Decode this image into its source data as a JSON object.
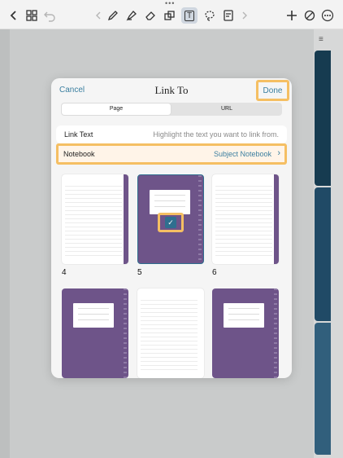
{
  "toolbar": {
    "grabber": "•••",
    "icons": [
      "chevron-left-icon",
      "grid-icon",
      "undo-icon",
      "chevron-left-small-icon",
      "pen-icon",
      "highlighter-icon",
      "eraser-icon",
      "shapes-icon",
      "text-icon",
      "lasso-icon",
      "sticker-icon",
      "chevron-right-small-icon",
      "plus-icon",
      "no-draw-icon",
      "more-icon"
    ],
    "text_tool": "T"
  },
  "dialog": {
    "cancel_label": "Cancel",
    "title": "Link To",
    "done_label": "Done",
    "segments": {
      "page": "Page",
      "url": "URL"
    },
    "link_text_label": "Link Text",
    "link_text_placeholder": "Highlight the text you want to link from.",
    "notebook_label": "Notebook",
    "notebook_value": "Subject Notebook",
    "chevron": "›",
    "check": "✓",
    "pages": [
      {
        "number": "4",
        "style": "white-lined"
      },
      {
        "number": "5",
        "style": "purple-cover",
        "selected": true
      },
      {
        "number": "6",
        "style": "white-lined"
      },
      {
        "number": "",
        "style": "purple-cover"
      },
      {
        "number": "",
        "style": "white-plain"
      },
      {
        "number": "",
        "style": "purple-cover"
      }
    ]
  },
  "sidebar": {
    "menu_icon": "≡"
  },
  "colors": {
    "accent": "#3b7fa0",
    "highlight": "#f5bf63",
    "cover": "#6e5489",
    "tab_dark": "#163b50"
  }
}
